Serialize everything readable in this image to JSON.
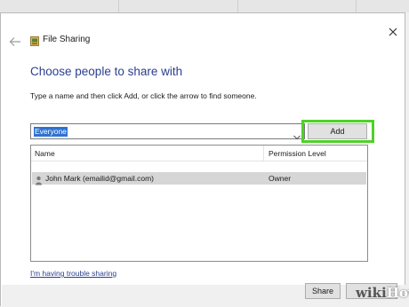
{
  "window": {
    "title": "File Sharing",
    "icons": {
      "back": "back-arrow-icon",
      "app": "file-sharing-icon",
      "close": "close-icon"
    }
  },
  "main": {
    "heading": "Choose people to share with",
    "instruction": "Type a name and then click Add, or click the arrow to find someone.",
    "name_input": {
      "value": "Everyone",
      "dropdown_icon": "chevron-down-icon"
    },
    "add_label": "Add",
    "highlight_color": "#4ed227"
  },
  "list": {
    "columns": [
      "Name",
      "Permission Level"
    ],
    "rows": [
      {
        "name": "John Mark (emailid@gmail.com)",
        "permission": "Owner",
        "icon": "user-icon"
      }
    ]
  },
  "trouble_link": "I'm having trouble sharing",
  "footer": {
    "share_label": "Share"
  },
  "watermark": {
    "part1": "wiki",
    "part2": "How"
  },
  "colors": {
    "accent_text": "#2b3f8f",
    "selection": "#2f72d2",
    "row_selected": "#d6d6d6"
  }
}
